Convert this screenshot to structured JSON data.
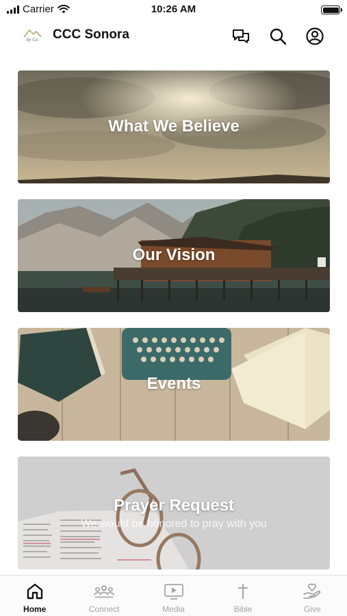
{
  "status_bar": {
    "carrier": "Carrier",
    "time": "10:26 AM"
  },
  "header": {
    "logo_text": "ity Co",
    "title": "CCC Sonora",
    "icons": [
      "chat-bubbles-icon",
      "search-icon",
      "user-account-icon"
    ]
  },
  "cards": [
    {
      "label": "What We Believe",
      "subtitle": ""
    },
    {
      "label": "Our Vision",
      "subtitle": ""
    },
    {
      "label": "Events",
      "subtitle": ""
    },
    {
      "label": "Prayer Request",
      "subtitle": "We would be honored to pray with you"
    }
  ],
  "tab_bar": {
    "active": "Home",
    "tabs": [
      {
        "label": "Home",
        "icon": "home-icon"
      },
      {
        "label": "Connect",
        "icon": "people-icon"
      },
      {
        "label": "Media",
        "icon": "play-screen-icon"
      },
      {
        "label": "Bible",
        "icon": "cross-icon"
      },
      {
        "label": "Give",
        "icon": "heart-hand-icon"
      }
    ]
  },
  "colors": {
    "active_tab": "#111111",
    "inactive_tab": "#a3a3a3"
  }
}
